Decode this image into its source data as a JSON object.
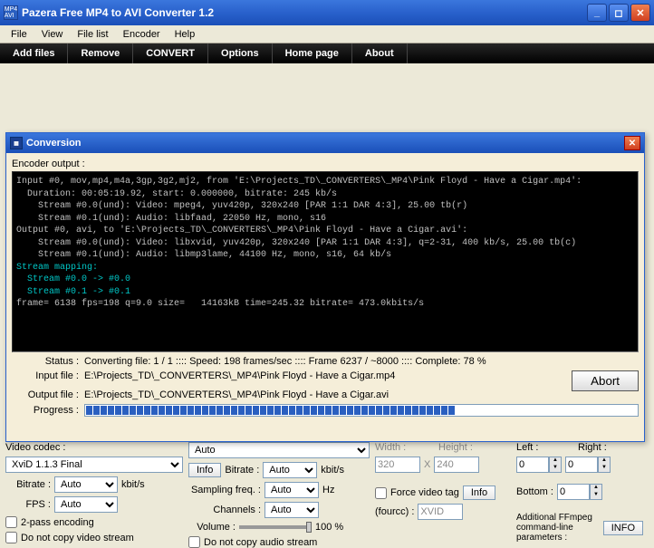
{
  "window": {
    "title": "Pazera Free MP4 to AVI Converter 1.2",
    "icon_text": "MP4\nAVI"
  },
  "menu": [
    "File",
    "View",
    "File list",
    "Encoder",
    "Help"
  ],
  "toolbar": [
    "Add files",
    "Remove",
    "CONVERT",
    "Options",
    "Home page",
    "About"
  ],
  "modal": {
    "title": "Conversion",
    "encoder_output_label": "Encoder output :",
    "console_lines": [
      {
        "cyan": false,
        "text": "Input #0, mov,mp4,m4a,3gp,3g2,mj2, from 'E:\\Projects_TD\\_CONVERTERS\\_MP4\\Pink Floyd - Have a Cigar.mp4':"
      },
      {
        "cyan": false,
        "text": "  Duration: 00:05:19.92, start: 0.000000, bitrate: 245 kb/s"
      },
      {
        "cyan": false,
        "text": "    Stream #0.0(und): Video: mpeg4, yuv420p, 320x240 [PAR 1:1 DAR 4:3], 25.00 tb(r)"
      },
      {
        "cyan": false,
        "text": "    Stream #0.1(und): Audio: libfaad, 22050 Hz, mono, s16"
      },
      {
        "cyan": false,
        "text": "Output #0, avi, to 'E:\\Projects_TD\\_CONVERTERS\\_MP4\\Pink Floyd - Have a Cigar.avi':"
      },
      {
        "cyan": false,
        "text": "    Stream #0.0(und): Video: libxvid, yuv420p, 320x240 [PAR 1:1 DAR 4:3], q=2-31, 400 kb/s, 25.00 tb(c)"
      },
      {
        "cyan": false,
        "text": "    Stream #0.1(und): Audio: libmp3lame, 44100 Hz, mono, s16, 64 kb/s"
      },
      {
        "cyan": true,
        "text": "Stream mapping:"
      },
      {
        "cyan": true,
        "text": "  Stream #0.0 -> #0.0"
      },
      {
        "cyan": true,
        "text": "  Stream #0.1 -> #0.1"
      },
      {
        "cyan": false,
        "text": "frame= 6138 fps=198 q=9.0 size=   14163kB time=245.32 bitrate= 473.0kbits/s"
      }
    ],
    "status_label": "Status :",
    "status_value": "Converting file: 1 / 1  ::::  Speed: 198 frames/sec  ::::  Frame 6237 / ~8000  ::::  Complete: 78 %",
    "input_label": "Input file :",
    "input_value": "E:\\Projects_TD\\_CONVERTERS\\_MP4\\Pink Floyd - Have a Cigar.mp4",
    "output_label": "Output file :",
    "output_value": "E:\\Projects_TD\\_CONVERTERS\\_MP4\\Pink Floyd - Have a Cigar.avi",
    "progress_label": "Progress :",
    "progress_percent": 78,
    "abort": "Abort"
  },
  "video": {
    "codec_label": "Video codec :",
    "codec_value": "XviD 1.1.3 Final",
    "bitrate_label": "Bitrate :",
    "bitrate_value": "Auto",
    "bitrate_unit": "kbit/s",
    "fps_label": "FPS :",
    "fps_value": "Auto",
    "twopass": "2-pass encoding",
    "nocopy": "Do not copy video stream"
  },
  "audio": {
    "top_value": "Auto",
    "info": "Info",
    "bitrate_label": "Bitrate :",
    "bitrate_value": "Auto",
    "bitrate_unit": "kbit/s",
    "samp_label": "Sampling freq. :",
    "samp_value": "Auto",
    "samp_unit": "Hz",
    "chan_label": "Channels :",
    "chan_value": "Auto",
    "vol_label": "Volume :",
    "vol_value": "100 %",
    "nocopy": "Do not copy audio stream"
  },
  "size": {
    "width_label": "Width :",
    "height_label": "Height :",
    "width_value": "320",
    "height_value": "240",
    "x": "X",
    "force_label": "Force video tag",
    "info": "Info",
    "fourcc_label": "(fourcc) :",
    "fourcc_value": "XVID"
  },
  "crop": {
    "left_label": "Left :",
    "right_label": "Right :",
    "bottom_label": "Bottom :",
    "left_value": "0",
    "right_value": "0",
    "bottom_value": "0"
  },
  "extra": {
    "label": "Additional FFmpeg command-line parameters :",
    "info": "INFO"
  }
}
